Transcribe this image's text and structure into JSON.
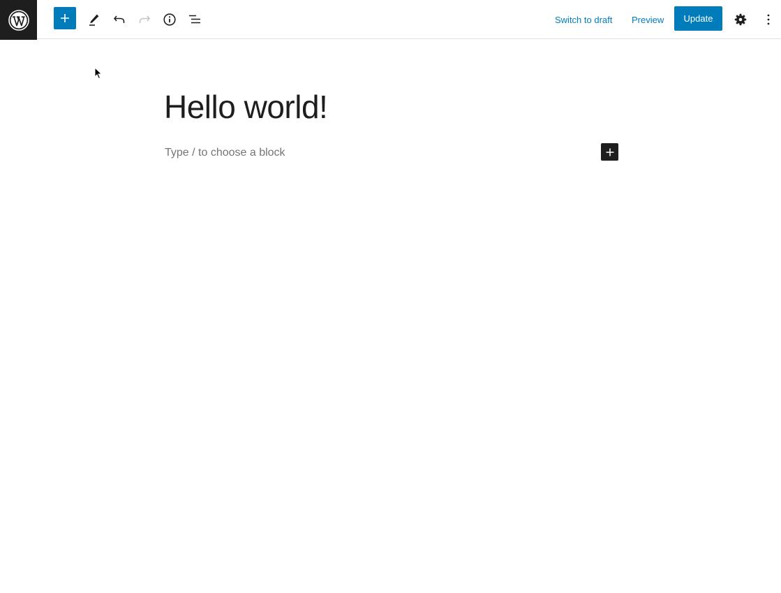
{
  "toolbar": {
    "logo_icon": "wordpress-logo-icon",
    "inserter_icon": "plus-icon",
    "tools_icon": "pencil-icon",
    "undo_icon": "undo-icon",
    "redo_icon": "redo-icon",
    "details_icon": "info-icon",
    "list_view_icon": "list-view-icon",
    "switch_to_draft_label": "Switch to draft",
    "preview_label": "Preview",
    "update_label": "Update",
    "settings_icon": "gear-icon",
    "options_icon": "more-vertical-icon"
  },
  "editor": {
    "title": "Hello world!",
    "block_placeholder": "Type / to choose a block",
    "block_inserter_icon": "plus-icon"
  },
  "colors": {
    "accent": "#007cba",
    "dark": "#1e1e1e",
    "placeholder": "#757575",
    "disabled": "#c3c4c7"
  }
}
